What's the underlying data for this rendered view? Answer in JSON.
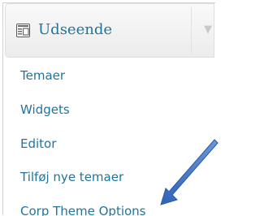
{
  "menu": {
    "header": {
      "title": "Udseende",
      "icon": "appearance-icon",
      "toggle_icon": "triangle-down-icon"
    },
    "items": [
      {
        "label": "Temaer"
      },
      {
        "label": "Widgets"
      },
      {
        "label": "Editor"
      },
      {
        "label": "Tilføj nye temaer"
      },
      {
        "label": "Corp Theme Options"
      }
    ]
  },
  "colors": {
    "link": "#21759b",
    "arrow": "#3a6fbf"
  }
}
